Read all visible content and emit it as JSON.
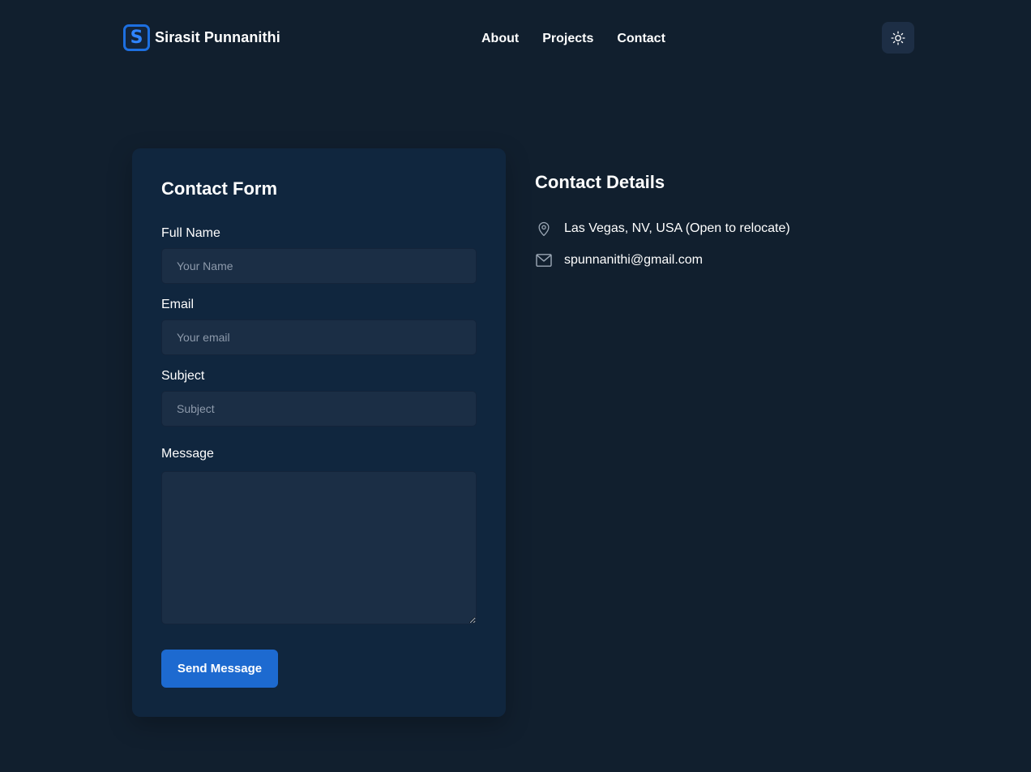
{
  "header": {
    "brand": {
      "logo_letter": "S",
      "name": "Sirasit Punnanithi"
    },
    "nav": {
      "about": "About",
      "projects": "Projects",
      "contact": "Contact"
    },
    "theme_toggle_icon": "sun-icon"
  },
  "form": {
    "title": "Contact Form",
    "full_name": {
      "label": "Full Name",
      "placeholder": "Your Name",
      "value": ""
    },
    "email": {
      "label": "Email",
      "placeholder": "Your email",
      "value": ""
    },
    "subject": {
      "label": "Subject",
      "placeholder": "Subject",
      "value": ""
    },
    "message": {
      "label": "Message",
      "placeholder": "",
      "value": ""
    },
    "submit_label": "Send Message"
  },
  "details": {
    "title": "Contact Details",
    "location": {
      "icon": "map-pin-icon",
      "text": "Las Vegas, NV, USA (Open to relocate)"
    },
    "email": {
      "icon": "mail-icon",
      "text": "spunnanithi@gmail.com"
    }
  },
  "colors": {
    "background": "#111f2e",
    "card": "#10263e",
    "input": "#1b2e45",
    "accent": "#1d6ad0",
    "text": "#ffffff",
    "placeholder": "#8d9aab"
  }
}
